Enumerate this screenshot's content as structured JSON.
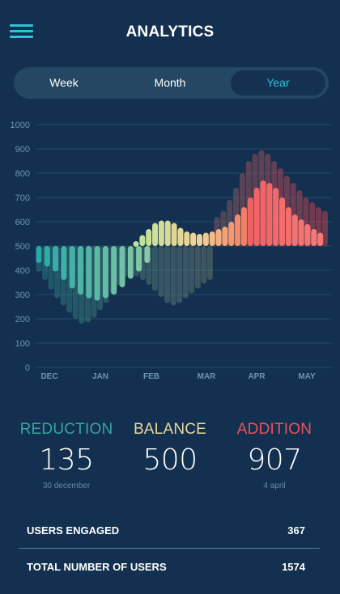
{
  "header": {
    "title": "ANALYTICS",
    "menu_icon": "hamburger-menu-icon"
  },
  "tabs": [
    {
      "label": "Week",
      "active": false
    },
    {
      "label": "Month",
      "active": false
    },
    {
      "label": "Year",
      "active": true
    }
  ],
  "colors": {
    "background": "#133050",
    "accent": "#2cc3d4",
    "reduction": "#33a79f",
    "balance": "#ead79a",
    "addition": "#ee5258"
  },
  "chart_data": {
    "type": "bar",
    "baseline": 500,
    "ylim": [
      0,
      1000
    ],
    "y_ticks": [
      "0",
      "100",
      "200",
      "300",
      "400",
      "500",
      "600",
      "700",
      "800",
      "900",
      "1000"
    ],
    "x_tick_labels": [
      "DEC",
      "JAN",
      "FEB",
      "MAR",
      "APR",
      "MAY"
    ],
    "grid": true,
    "series": [
      {
        "values": [
          430,
          415,
          395,
          360,
          325,
          300,
          285,
          275,
          285,
          300,
          330,
          365,
          395,
          430
        ]
      },
      {
        "values": [
          520,
          545,
          570,
          595,
          605,
          605,
          595,
          575,
          560,
          555,
          550,
          555,
          560,
          570,
          580,
          600,
          630,
          660,
          700,
          740,
          770,
          760,
          740,
          700,
          660,
          630,
          610,
          590,
          570,
          555
        ]
      }
    ],
    "background_bars": [
      {
        "values": [
          395,
          360,
          320,
          285,
          255,
          225,
          200,
          180,
          185,
          205,
          235,
          265,
          305,
          340,
          370,
          380,
          375,
          360,
          340,
          315,
          290,
          265,
          255,
          265,
          285,
          305,
          325,
          345,
          360
        ]
      },
      {
        "values": [
          620,
          645,
          690,
          740,
          800,
          850,
          880,
          895,
          880,
          850,
          820,
          790,
          760,
          730,
          700,
          680,
          660,
          645
        ]
      }
    ]
  },
  "stats": {
    "reduction": {
      "label": "REDUCTION",
      "value": "135",
      "date": "30 december"
    },
    "balance": {
      "label": "BALANCE",
      "value": "500",
      "date": ""
    },
    "addition": {
      "label": "ADDITION",
      "value": "907",
      "date": "4 april"
    }
  },
  "summary": [
    {
      "label": "USERS ENGAGED",
      "value": "367"
    },
    {
      "label": "TOTAL NUMBER OF USERS",
      "value": "1574"
    }
  ]
}
